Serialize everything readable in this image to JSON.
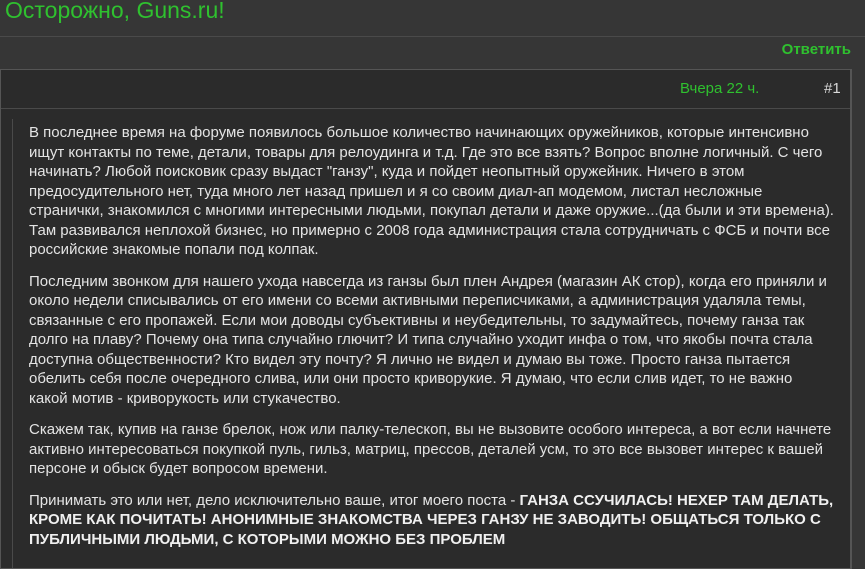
{
  "site": {
    "title": "Осторожно, Guns.ru!"
  },
  "actions": {
    "reply_label": "Ответить"
  },
  "post": {
    "date": "Вчера 22 ч.",
    "number": "#1",
    "paragraphs": [
      "В последнее время на форуме появилось большое количество начинающих оружейников, которые интенсивно ищут контакты по теме, детали, товары для релоудинга и т.д. Где это все взять? Вопрос вполне логичный. С чего начинать? Любой поисковик сразу выдаст \"ганзу\", куда и пойдет неопытный оружейник. Ничего в этом предосудительного нет, туда много лет назад пришел и я со своим диал-ап модемом, листал несложные странички, знакомился с многими интересными людьми, покупал детали и даже оружие...(да были и эти времена). Там развивался неплохой бизнес, но примерно с 2008 года администрация стала сотрудничать с ФСБ и почти все российские знакомые попали под колпак.",
      "Последним звонком для нашего ухода навсегда из ганзы был плен Андрея (магазин АК стор), когда его приняли и около недели списывались от его имени со всеми активными переписчиками, а администрация удаляла темы, связанные с его пропажей. Если мои доводы субъективны и неубедительны, то задумайтесь, почему ганза так долго на плаву? Почему она типа случайно глючит? И типа случайно уходит инфа о том, что якобы почта стала доступна общественности? Кто видел эту почту? Я лично не видел и думаю вы тоже. Просто ганза пытается обелить себя после очередного слива, или они просто криворукие. Я думаю, что если слив идет, то не важно какой мотив - криворукость или стукачество.",
      "Скажем так, купив на ганзе брелок, нож или палку-телескоп, вы не вызовите особого интереса, а вот если начнете активно интересоваться покупкой пуль, гильз, матриц, прессов, деталей усм, то это все вызовет интерес к вашей персоне и обыск будет вопросом времени."
    ],
    "last_intro": "Принимать это или нет, дело исключительно ваше, итог моего поста - ",
    "last_bold": "ГАНЗА ССУЧИЛАСЬ! НЕХЕР ТАМ ДЕЛАТЬ, КРОМЕ КАК ПОЧИТАТЬ! АНОНИМНЫЕ ЗНАКОМСТВА ЧЕРЕЗ ГАНЗУ НЕ ЗАВОДИТЬ! ОБЩАТЬСЯ ТОЛЬКО С ПУБЛИЧНЫМИ ЛЮДЬМИ, С КОТОРЫМИ МОЖНО БЕЗ ПРОБЛЕМ"
  }
}
